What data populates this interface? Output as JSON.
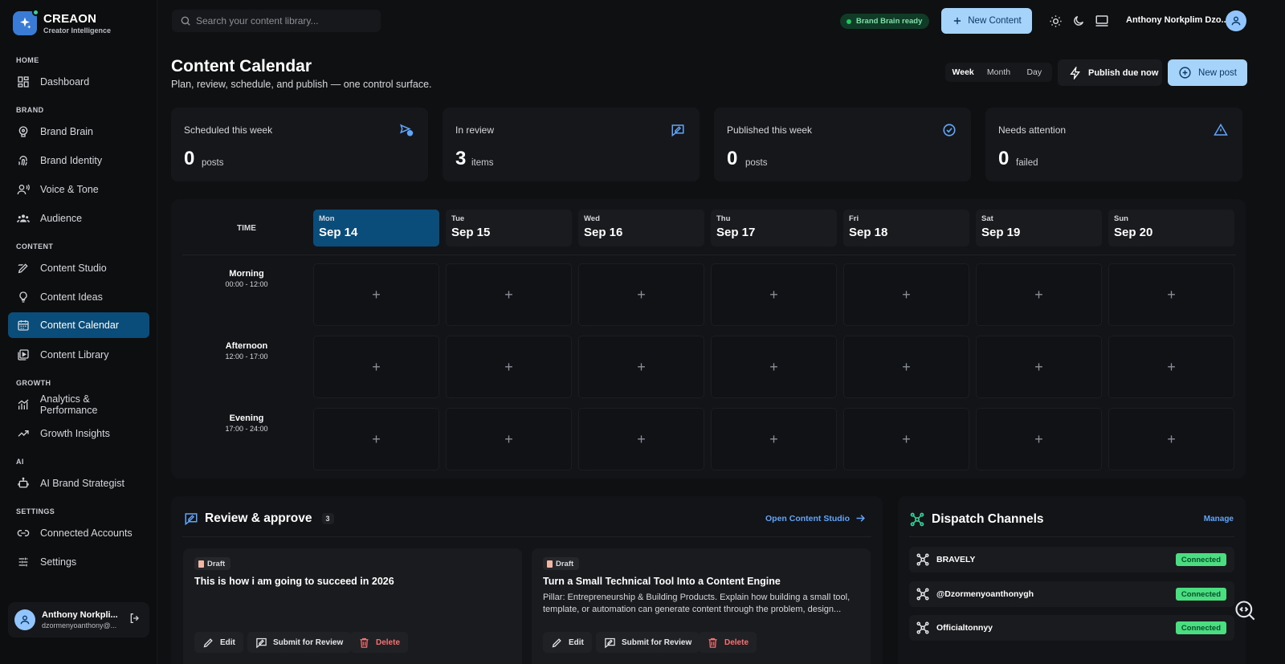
{
  "app": {
    "name": "CREAON",
    "tagline": "Creator Intelligence"
  },
  "sidebar": {
    "sections": [
      {
        "label": "HOME",
        "items": [
          {
            "label": "Dashboard",
            "icon": "dashboard-icon"
          }
        ]
      },
      {
        "label": "BRAND",
        "items": [
          {
            "label": "Brand Brain",
            "icon": "brain-icon"
          },
          {
            "label": "Brand Identity",
            "icon": "fingerprint-icon"
          },
          {
            "label": "Voice & Tone",
            "icon": "voice-icon"
          },
          {
            "label": "Audience",
            "icon": "audience-icon"
          }
        ]
      },
      {
        "label": "CONTENT",
        "items": [
          {
            "label": "Content Studio",
            "icon": "pen-icon"
          },
          {
            "label": "Content Ideas",
            "icon": "lightbulb-icon"
          },
          {
            "label": "Content Calendar",
            "icon": "calendar-icon",
            "active": true
          },
          {
            "label": "Content Library",
            "icon": "library-icon"
          }
        ]
      },
      {
        "label": "GROWTH",
        "items": [
          {
            "label": "Analytics & Performance",
            "icon": "analytics-icon"
          },
          {
            "label": "Growth Insights",
            "icon": "trend-icon"
          }
        ]
      },
      {
        "label": "AI",
        "items": [
          {
            "label": "AI Brand Strategist",
            "icon": "robot-icon"
          }
        ]
      },
      {
        "label": "SETTINGS",
        "items": [
          {
            "label": "Connected Accounts",
            "icon": "link-icon"
          },
          {
            "label": "Settings",
            "icon": "sliders-icon"
          }
        ]
      }
    ],
    "user": {
      "name": "Anthony Norkpli...",
      "email": "dzormenyoanthony@..."
    }
  },
  "topbar": {
    "search_placeholder": "Search your content library...",
    "brand_badge": "Brand Brain ready",
    "new_content": "New Content",
    "user_name": "Anthony Norkplim Dzo..."
  },
  "header": {
    "title": "Content Calendar",
    "subtitle": "Plan, review, schedule, and publish — one control surface.",
    "views": [
      "Week",
      "Month",
      "Day"
    ],
    "active_view": "Week",
    "publish_due": "Publish due now",
    "new_post": "New post"
  },
  "stats": [
    {
      "label": "Scheduled this week",
      "value": "0",
      "unit": "posts",
      "icon": "schedule-send-icon"
    },
    {
      "label": "In review",
      "value": "3",
      "unit": "items",
      "icon": "review-icon"
    },
    {
      "label": "Published this week",
      "value": "0",
      "unit": "posts",
      "icon": "check-circle-icon"
    },
    {
      "label": "Needs attention",
      "value": "0",
      "unit": "failed",
      "icon": "warning-icon"
    }
  ],
  "calendar": {
    "time_header": "TIME",
    "days": [
      {
        "dow": "Mon",
        "date": "Sep 14",
        "today": true
      },
      {
        "dow": "Tue",
        "date": "Sep 15"
      },
      {
        "dow": "Wed",
        "date": "Sep 16"
      },
      {
        "dow": "Thu",
        "date": "Sep 17"
      },
      {
        "dow": "Fri",
        "date": "Sep 18"
      },
      {
        "dow": "Sat",
        "date": "Sep 19"
      },
      {
        "dow": "Sun",
        "date": "Sep 20"
      }
    ],
    "slots": [
      {
        "name": "Morning",
        "time": "00:00 - 12:00"
      },
      {
        "name": "Afternoon",
        "time": "12:00 - 17:00"
      },
      {
        "name": "Evening",
        "time": "17:00 - 24:00"
      }
    ],
    "add_glyph": "+"
  },
  "review": {
    "title": "Review & approve",
    "count": "3",
    "open_link": "Open Content Studio",
    "cards": [
      {
        "status": "Draft",
        "title": "This is how i am going to succeed in 2026",
        "body": ""
      },
      {
        "status": "Draft",
        "title": "Turn a Small Technical Tool Into a Content Engine",
        "body": "Pillar: Entrepreneurship & Building Products. Explain how building a small tool, template, or automation can generate content through the problem, design..."
      }
    ],
    "actions": {
      "edit": "Edit",
      "submit": "Submit for Review",
      "delete": "Delete"
    }
  },
  "dispatch": {
    "title": "Dispatch Channels",
    "manage": "Manage",
    "channels": [
      {
        "name": "BRAVELY",
        "status": "Connected"
      },
      {
        "name": "@Dzormenyoanthonygh",
        "status": "Connected"
      },
      {
        "name": "Officialtonnyy",
        "status": "Connected"
      }
    ]
  },
  "colors": {
    "accent": "#a6d3fa",
    "active": "#0b4d7a",
    "success": "#4ade80",
    "danger": "#f87171",
    "link": "#60a5fa"
  }
}
